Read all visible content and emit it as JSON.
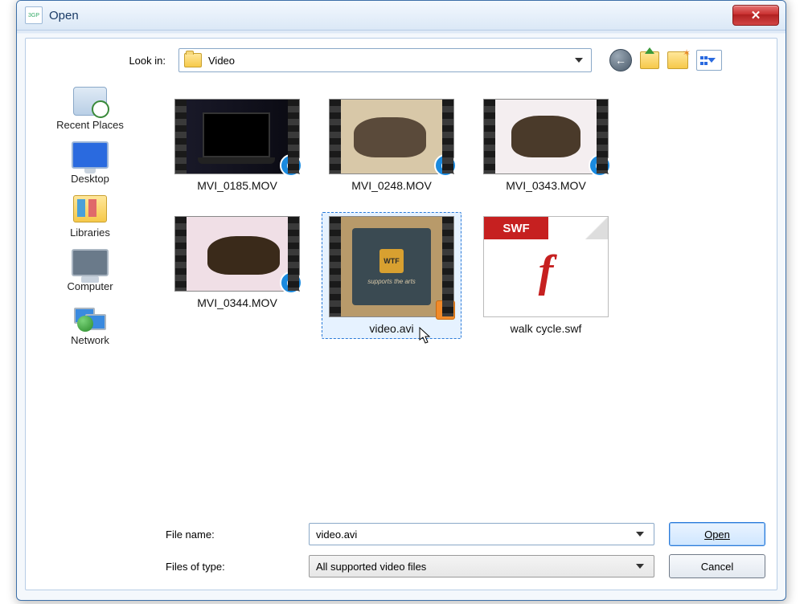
{
  "window": {
    "title": "Open"
  },
  "lookin": {
    "label": "Look in:",
    "folder": "Video"
  },
  "places": [
    {
      "id": "recent",
      "label": "Recent Places"
    },
    {
      "id": "desktop",
      "label": "Desktop"
    },
    {
      "id": "libraries",
      "label": "Libraries"
    },
    {
      "id": "computer",
      "label": "Computer"
    },
    {
      "id": "network",
      "label": "Network"
    }
  ],
  "files": [
    {
      "name": "MVI_0185.MOV",
      "kind": "mov",
      "selected": false
    },
    {
      "name": "MVI_0248.MOV",
      "kind": "mov",
      "selected": false
    },
    {
      "name": "MVI_0343.MOV",
      "kind": "mov",
      "selected": false
    },
    {
      "name": "MVI_0344.MOV",
      "kind": "mov",
      "selected": false
    },
    {
      "name": "video.avi",
      "kind": "avi",
      "selected": true
    },
    {
      "name": "walk cycle.swf",
      "kind": "swf",
      "selected": false
    }
  ],
  "filename": {
    "label": "File name:",
    "value": "video.avi"
  },
  "filter": {
    "label": "Files of type:",
    "value": "All supported video files"
  },
  "buttons": {
    "open": "Open",
    "cancel": "Cancel"
  },
  "avi_overlay": {
    "logo": "WTF",
    "sub": "supports the arts"
  },
  "swf_badge": "SWF",
  "app_icon_text": "3GP"
}
